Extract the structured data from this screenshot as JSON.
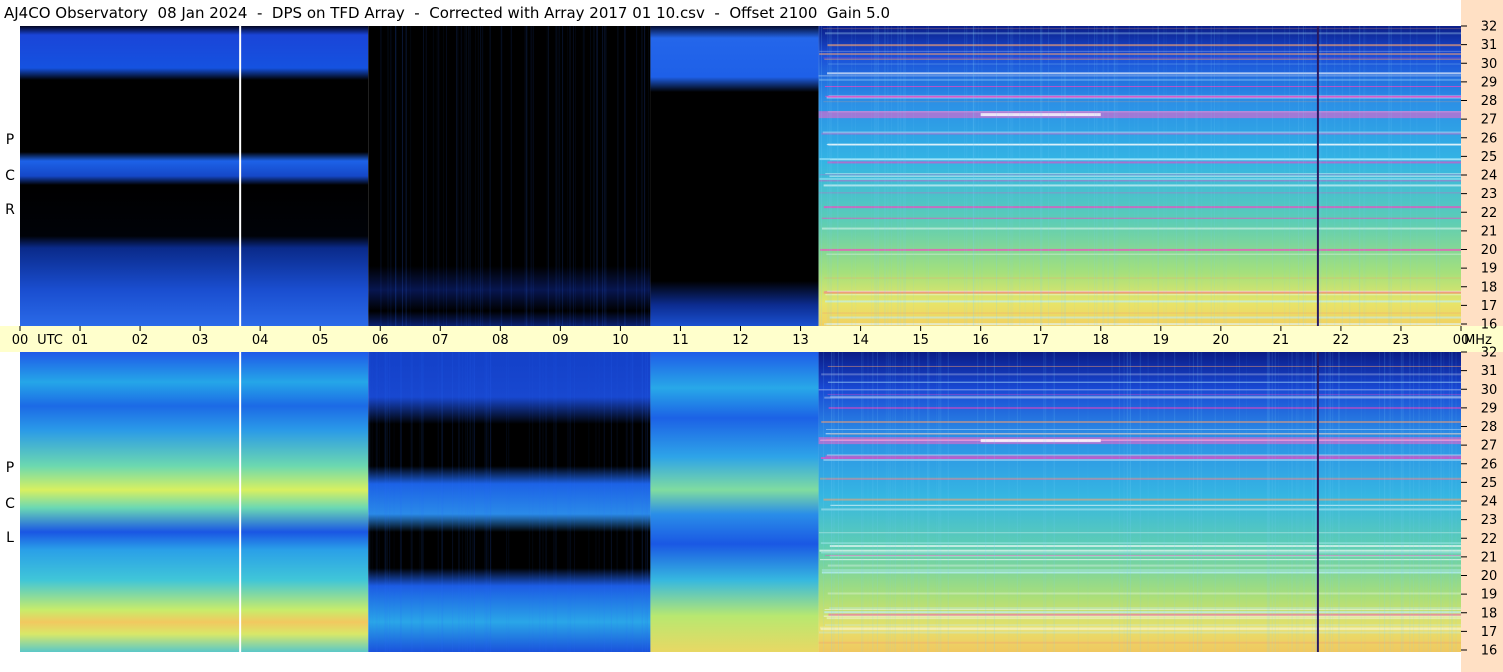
{
  "title": "AJ4CO Observatory  08 Jan 2024  -  DPS on TFD Array  -  Corrected with Array 2017 01 10.csv  -  Offset 2100  Gain 5.0",
  "top_panel": {
    "channel_letters": [
      "R",
      "C",
      "P"
    ]
  },
  "bottom_panel": {
    "channel_letters": [
      "L",
      "C",
      "P"
    ]
  },
  "time_axis": {
    "labels": [
      "00",
      "UTC",
      "01",
      "02",
      "03",
      "04",
      "05",
      "06",
      "07",
      "08",
      "09",
      "10",
      "11",
      "12",
      "13",
      "14",
      "15",
      "16",
      "17",
      "18",
      "19",
      "20",
      "21",
      "22",
      "23",
      "00",
      "MHz"
    ]
  },
  "colors": {
    "background": "#ffffff",
    "time_strip": "#ffffcc",
    "freq_strip": "#ffe0c4",
    "quiet": "#000000",
    "deep_blue": "#0a1a8a",
    "blue": "#1e5de6",
    "cyan": "#2bb5e0",
    "green": "#7ed8a0",
    "yellow": "#f2e860",
    "orange": "#f5a070",
    "magenta": "#ff40c0"
  },
  "chart_data": {
    "type": "heatmap",
    "panels": [
      "RCP",
      "LCP"
    ],
    "x_unit": "UTC hour",
    "x_range": [
      0,
      24
    ],
    "y_unit": "MHz",
    "y_range": [
      16,
      32
    ],
    "y_ticks": [
      16,
      17,
      18,
      19,
      20,
      21,
      22,
      23,
      24,
      25,
      26,
      27,
      28,
      29,
      30,
      31,
      32
    ],
    "x_ticks": [
      "00",
      "01",
      "02",
      "03",
      "04",
      "05",
      "06",
      "07",
      "08",
      "09",
      "10",
      "11",
      "12",
      "13",
      "14",
      "15",
      "16",
      "17",
      "18",
      "19",
      "20",
      "21",
      "22",
      "23",
      "00"
    ],
    "color_scale": [
      "black",
      "deep blue",
      "blue",
      "cyan",
      "green",
      "yellow",
      "orange",
      "magenta",
      "white"
    ],
    "rcp_regions": [
      {
        "x": [
          0.0,
          5.8
        ],
        "y": [
          28.7,
          32.0
        ],
        "level": "blue"
      },
      {
        "x": [
          0.0,
          5.8
        ],
        "y": [
          24.2,
          25.0
        ],
        "level": "blue"
      },
      {
        "x": [
          0.0,
          5.8
        ],
        "y": [
          16.0,
          20.5
        ],
        "level": "deep blue"
      },
      {
        "x": [
          5.8,
          10.5
        ],
        "y": [
          16.0,
          32.0
        ],
        "level": "black"
      },
      {
        "x": [
          10.5,
          13.3
        ],
        "y": [
          29.0,
          32.0
        ],
        "level": "blue"
      },
      {
        "x": [
          13.3,
          24.0
        ],
        "y": [
          16.0,
          32.0
        ],
        "level": "cyan"
      }
    ],
    "lcp_regions": [
      {
        "x": [
          0.0,
          5.8
        ],
        "y": [
          16.0,
          32.0
        ],
        "level": "cyan"
      },
      {
        "x": [
          0.0,
          5.8
        ],
        "y": [
          24.0,
          25.0
        ],
        "level": "yellow"
      },
      {
        "x": [
          0.0,
          5.8
        ],
        "y": [
          17.5,
          18.8
        ],
        "level": "yellow"
      },
      {
        "x": [
          5.8,
          10.5
        ],
        "y": [
          16.0,
          32.0
        ],
        "level": "blue"
      },
      {
        "x": [
          10.5,
          13.3
        ],
        "y": [
          16.0,
          32.0
        ],
        "level": "cyan"
      },
      {
        "x": [
          13.3,
          24.0
        ],
        "y": [
          16.0,
          32.0
        ],
        "level": "cyan"
      }
    ],
    "interference_lines_utc": [
      3.65,
      21.6
    ]
  }
}
